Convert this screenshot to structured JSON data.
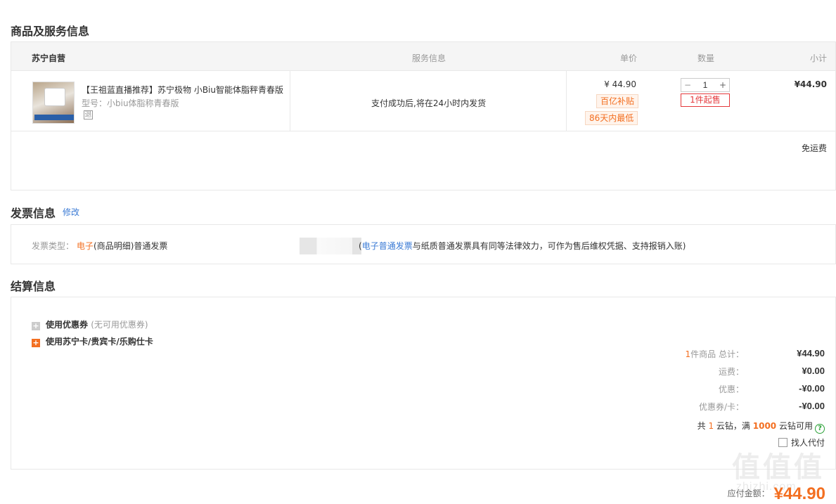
{
  "sections": {
    "goods_title": "商品及服务信息",
    "invoice_title": "发票信息",
    "settlement_title": "结算信息"
  },
  "goods": {
    "store": "苏宁自营",
    "headers": {
      "service": "服务信息",
      "price": "单价",
      "qty": "数量",
      "subtotal": "小计"
    },
    "item": {
      "title": "【王祖蓝直播推荐】苏宁极物 小Biu智能体脂秤青春版",
      "model": "型号：小biu体脂称青春版",
      "return_badge": "退",
      "service": "支付成功后,将在24小时内发货",
      "price": "¥ 44.90",
      "tags": [
        "百亿补贴",
        "86天内最低"
      ],
      "quantity": "1",
      "minus": "−",
      "plus": "+",
      "min_order": "1件起售",
      "subtotal": "¥44.90"
    },
    "shipping": "免运费"
  },
  "invoice": {
    "edit": "修改",
    "label": "发票类型：",
    "type_prefix": "电子",
    "type_rest": "(商品明细)普通发票",
    "note_link": "电子普通发票",
    "note_prefix": "(",
    "note_rest": "与纸质普通发票具有同等法律效力，可作为售后维权凭据、支持报销入账)"
  },
  "settlement": {
    "coupon_label": "使用优惠券",
    "coupon_note": "(无可用优惠券)",
    "card_label": "使用苏宁卡/贵宾卡/乐购仕卡",
    "summary": [
      {
        "count": "1",
        "label": "件商品 总计：",
        "value": "¥44.90"
      },
      {
        "label": "运费：",
        "value": "¥0.00"
      },
      {
        "label": "优惠：",
        "value": "-¥0.00"
      },
      {
        "label": "优惠券/卡：",
        "value": "-¥0.00"
      }
    ],
    "yunzuan": {
      "pre": "共",
      "count": "1",
      "mid": "云钻，满",
      "threshold": "1000",
      "post": "云钻可用",
      "help": "?"
    },
    "proxy_pay": "找人代付"
  },
  "payable": {
    "label": "应付金额：",
    "amount": "¥44.90"
  },
  "watermark": {
    "glyphs": "值值值",
    "text": "zhizhi.com"
  },
  "colors": {
    "accent": "#f36f21",
    "link": "#3b7bd5",
    "red": "#e4393c"
  }
}
